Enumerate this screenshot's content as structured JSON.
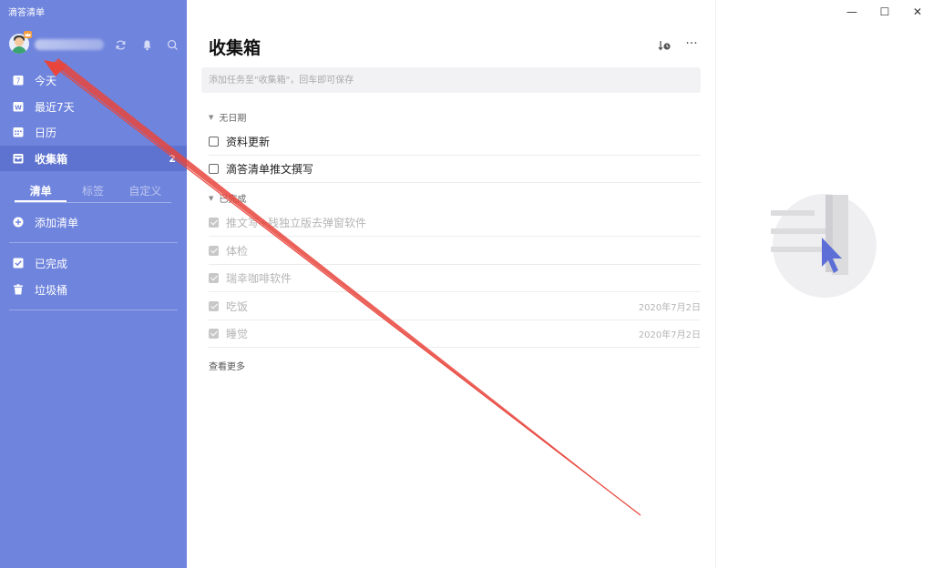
{
  "app": {
    "title": "滴答清单"
  },
  "sidebar": {
    "nav": [
      {
        "label": "今天",
        "icon": "calendar-7-icon"
      },
      {
        "label": "最近7天",
        "icon": "week-w-icon"
      },
      {
        "label": "日历",
        "icon": "calendar-grid-icon"
      },
      {
        "label": "收集箱",
        "icon": "inbox-icon",
        "count": "2",
        "active": true
      }
    ],
    "tabs": [
      {
        "label": "清单",
        "active": true
      },
      {
        "label": "标签"
      },
      {
        "label": "自定义"
      }
    ],
    "add_list": "添加清单",
    "completed": "已完成",
    "trash": "垃圾桶"
  },
  "main": {
    "title": "收集箱",
    "input_placeholder": "添加任务至\"收集箱\"，回车即可保存",
    "sections": [
      {
        "title": "无日期",
        "tasks": [
          {
            "text": "资料更新",
            "done": false
          },
          {
            "text": "滴答清单推文撰写",
            "done": false
          }
        ]
      },
      {
        "title": "已完成",
        "tasks": [
          {
            "text": "推文写+残独立版去弹窗软件",
            "done": true
          },
          {
            "text": "体检",
            "done": true
          },
          {
            "text": "瑞幸咖啡软件",
            "done": true
          },
          {
            "text": "吃饭",
            "done": true,
            "date": "2020年7月2日"
          },
          {
            "text": "睡觉",
            "done": true,
            "date": "2020年7月2日"
          }
        ]
      }
    ],
    "view_more": "查看更多"
  },
  "colors": {
    "sidebar": "#6f84dd",
    "sidebar_active": "#5e73cf",
    "arrow": "#e8453c",
    "accent": "#5d6fd6"
  }
}
